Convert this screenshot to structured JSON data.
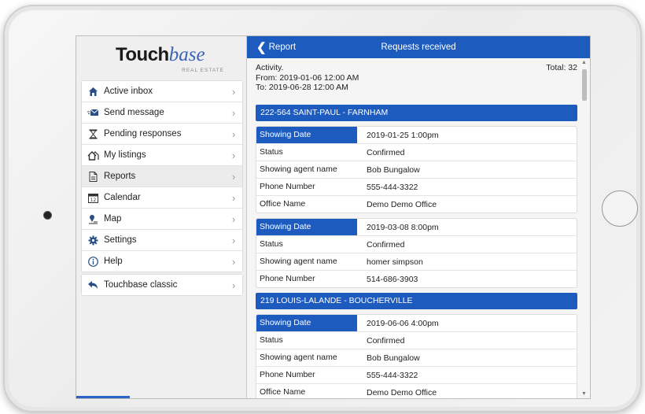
{
  "logo": {
    "touch": "Touch",
    "base": "base",
    "sub": "REAL ESTATE"
  },
  "sidebar": {
    "items": [
      {
        "label": "Active inbox",
        "icon": "home-icon"
      },
      {
        "label": "Send message",
        "icon": "send-icon"
      },
      {
        "label": "Pending responses",
        "icon": "hourglass-icon"
      },
      {
        "label": "My listings",
        "icon": "houses-icon"
      },
      {
        "label": "Reports",
        "icon": "document-icon"
      },
      {
        "label": "Calendar",
        "icon": "calendar-icon"
      },
      {
        "label": "Map",
        "icon": "map-pin-icon"
      },
      {
        "label": "Settings",
        "icon": "gear-icon"
      },
      {
        "label": "Help",
        "icon": "info-icon"
      }
    ],
    "classic": {
      "label": "Touchbase classic",
      "icon": "back-arrow-icon"
    }
  },
  "topbar": {
    "back_label": "Report",
    "title": "Requests received"
  },
  "info": {
    "activity": "Activity.",
    "from": "From: 2019-01-06 12:00 AM",
    "to": "To: 2019-06-28 12:00 AM",
    "total": "Total: 32"
  },
  "colors": {
    "accent": "#1e5bbf",
    "sidebar_bg": "#efefef"
  },
  "groups": [
    {
      "address": "222-564 SAINT-PAUL - FARNHAM",
      "cards": [
        [
          {
            "k": "Showing Date",
            "v": "2019-01-25 1:00pm"
          },
          {
            "k": "Status",
            "v": "Confirmed"
          },
          {
            "k": "Showing agent name",
            "v": "Bob Bungalow"
          },
          {
            "k": "Phone Number",
            "v": "555-444-3322"
          },
          {
            "k": "Office Name",
            "v": "Demo Demo Office"
          }
        ],
        [
          {
            "k": "Showing Date",
            "v": "2019-03-08 8:00pm"
          },
          {
            "k": "Status",
            "v": "Confirmed"
          },
          {
            "k": "Showing agent name",
            "v": "homer simpson"
          },
          {
            "k": "Phone Number",
            "v": "514-686-3903"
          }
        ]
      ]
    },
    {
      "address": "219 LOUIS-LALANDE - BOUCHERVILLE",
      "cards": [
        [
          {
            "k": "Showing Date",
            "v": "2019-06-06 4:00pm"
          },
          {
            "k": "Status",
            "v": "Confirmed"
          },
          {
            "k": "Showing agent name",
            "v": "Bob Bungalow"
          },
          {
            "k": "Phone Number",
            "v": "555-444-3322"
          },
          {
            "k": "Office Name",
            "v": "Demo Demo Office"
          }
        ]
      ]
    }
  ]
}
